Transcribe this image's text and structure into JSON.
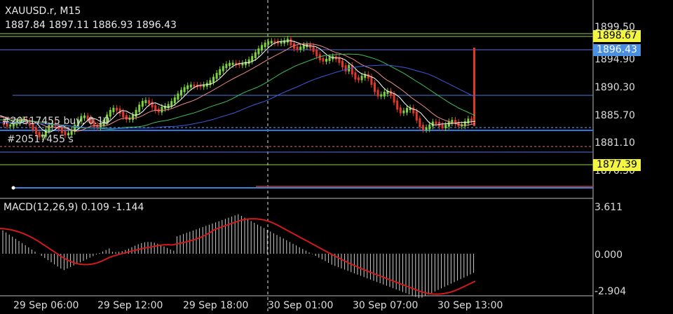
{
  "header": {
    "symbol_tf": "XAUUSD.r, M15",
    "ohlc": "1887.84 1897.11 1886.93 1896.43"
  },
  "orders": {
    "order1": "#20517455 buy, 0.10",
    "order2": "#20517455 s"
  },
  "price_axis": {
    "labels": [
      "1899.50",
      "1894.90",
      "1890.30",
      "1885.70",
      "1881.10",
      "1876.50"
    ]
  },
  "price_tags": {
    "high_line": "1898.67",
    "current": "1896.43",
    "low_line": "1877.39"
  },
  "macd": {
    "label": "MACD(12,26,9) 0.109 -1.144",
    "axis": [
      "3.611",
      "0.000",
      "-2.904"
    ]
  },
  "time_axis": [
    "29 Sep 06:00",
    "29 Sep 12:00",
    "29 Sep 18:00",
    "30 Sep 01:00",
    "30 Sep 07:00",
    "30 Sep 13:00"
  ],
  "colors": {
    "bull": "#7cd33a",
    "bear": "#e0372a",
    "ma_fast": "#ffffff",
    "ma_pink": "#f08a8a",
    "ma_green": "#3fbf5a",
    "ma_blue": "#3b5bd9",
    "macd_signal": "#d11a1a",
    "tag_yellow": "#f2f542",
    "tag_blue": "#4a8fe0"
  }
}
